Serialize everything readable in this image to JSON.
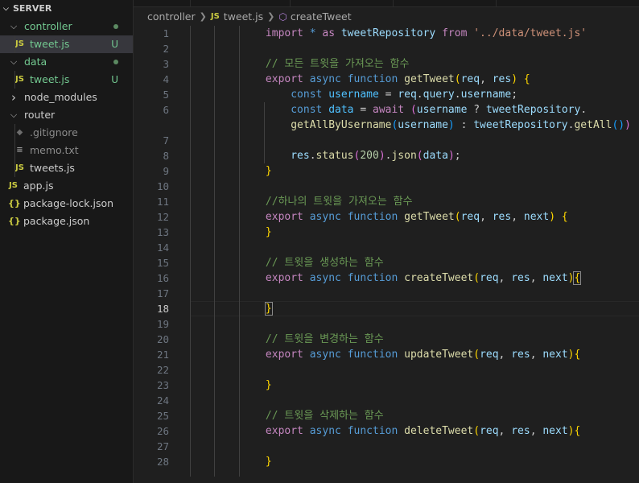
{
  "explorer": {
    "title": "SERVER",
    "items": [
      {
        "label": "controller",
        "type": "folder",
        "open": true,
        "level": 0,
        "status": "dot",
        "color": "green"
      },
      {
        "label": "tweet.js",
        "type": "js",
        "level": 1,
        "status": "U",
        "color": "green",
        "selected": true
      },
      {
        "label": "data",
        "type": "folder",
        "open": true,
        "level": 0,
        "status": "dot",
        "color": "green"
      },
      {
        "label": "tweet.js",
        "type": "js",
        "level": 1,
        "status": "U",
        "color": "green"
      },
      {
        "label": "node_modules",
        "type": "folder",
        "open": false,
        "level": 0
      },
      {
        "label": "router",
        "type": "folder",
        "open": true,
        "level": 0
      },
      {
        "label": ".gitignore",
        "type": "git",
        "level": 1,
        "color": "dim"
      },
      {
        "label": "memo.txt",
        "type": "txt",
        "level": 1,
        "color": "dim"
      },
      {
        "label": "tweets.js",
        "type": "js",
        "level": 1
      },
      {
        "label": "app.js",
        "type": "js",
        "level": 0
      },
      {
        "label": "package-lock.json",
        "type": "json",
        "level": 0
      },
      {
        "label": "package.json",
        "type": "json",
        "level": 0
      }
    ]
  },
  "breadcrumb": {
    "folder": "controller",
    "file_icon": "JS",
    "file": "tweet.js",
    "symbol": "createTweet"
  },
  "editor": {
    "active_line": 18,
    "lines": [
      {
        "n": "1",
        "tokens": [
          [
            "",
            "            "
          ],
          [
            "kw",
            "import"
          ],
          [
            "pn",
            " "
          ],
          [
            "kb",
            "*"
          ],
          [
            "pn",
            " "
          ],
          [
            "kw",
            "as"
          ],
          [
            "pn",
            " "
          ],
          [
            "var",
            "tweetRepository"
          ],
          [
            "pn",
            " "
          ],
          [
            "kw",
            "from"
          ],
          [
            "pn",
            " "
          ],
          [
            "str",
            "'../data/tweet.js'"
          ]
        ]
      },
      {
        "n": "2",
        "tokens": []
      },
      {
        "n": "3",
        "tokens": [
          [
            "",
            "            "
          ],
          [
            "cmt",
            "// 모든 트윗을 가져오는 함수"
          ]
        ]
      },
      {
        "n": "4",
        "tokens": [
          [
            "",
            "            "
          ],
          [
            "kw",
            "export"
          ],
          [
            "pn",
            " "
          ],
          [
            "kb",
            "async"
          ],
          [
            "pn",
            " "
          ],
          [
            "kb",
            "function"
          ],
          [
            "pn",
            " "
          ],
          [
            "fn",
            "getTweet"
          ],
          [
            "p1",
            "("
          ],
          [
            "var",
            "req"
          ],
          [
            "pn",
            ", "
          ],
          [
            "var",
            "res"
          ],
          [
            "p1",
            ")"
          ],
          [
            "pn",
            " "
          ],
          [
            "p1",
            "{"
          ]
        ]
      },
      {
        "n": "5",
        "tokens": [
          [
            "",
            "                "
          ],
          [
            "kb",
            "const"
          ],
          [
            "pn",
            " "
          ],
          [
            "cst",
            "username"
          ],
          [
            "pn",
            " = "
          ],
          [
            "var",
            "req"
          ],
          [
            "pn",
            "."
          ],
          [
            "var",
            "query"
          ],
          [
            "pn",
            "."
          ],
          [
            "var",
            "username"
          ],
          [
            "pn",
            ";"
          ]
        ]
      },
      {
        "n": "6",
        "tokens": [
          [
            "",
            "                "
          ],
          [
            "kb",
            "const"
          ],
          [
            "pn",
            " "
          ],
          [
            "cst",
            "data"
          ],
          [
            "pn",
            " = "
          ],
          [
            "kw",
            "await"
          ],
          [
            "pn",
            " "
          ],
          [
            "p2",
            "("
          ],
          [
            "var",
            "username"
          ],
          [
            "pn",
            " ? "
          ],
          [
            "var",
            "tweetRepository"
          ],
          [
            "pn",
            "."
          ]
        ]
      },
      {
        "n": "",
        "tokens": [
          [
            "",
            "                "
          ],
          [
            "fn",
            "getAllByUsername"
          ],
          [
            "p3",
            "("
          ],
          [
            "var",
            "username"
          ],
          [
            "p3",
            ")"
          ],
          [
            "pn",
            " : "
          ],
          [
            "var",
            "tweetRepository"
          ],
          [
            "pn",
            "."
          ],
          [
            "fn",
            "getAll"
          ],
          [
            "p3",
            "("
          ],
          [
            "p3",
            ")"
          ],
          [
            "p2",
            ")"
          ]
        ]
      },
      {
        "n": "7",
        "tokens": []
      },
      {
        "n": "8",
        "tokens": [
          [
            "",
            "                "
          ],
          [
            "var",
            "res"
          ],
          [
            "pn",
            "."
          ],
          [
            "fn",
            "status"
          ],
          [
            "p2",
            "("
          ],
          [
            "num",
            "200"
          ],
          [
            "p2",
            ")"
          ],
          [
            "pn",
            "."
          ],
          [
            "fn",
            "json"
          ],
          [
            "p2",
            "("
          ],
          [
            "var",
            "data"
          ],
          [
            "p2",
            ")"
          ],
          [
            "pn",
            ";"
          ]
        ]
      },
      {
        "n": "9",
        "tokens": [
          [
            "",
            "            "
          ],
          [
            "p1",
            "}"
          ]
        ]
      },
      {
        "n": "10",
        "tokens": []
      },
      {
        "n": "11",
        "tokens": [
          [
            "",
            "            "
          ],
          [
            "cmt",
            "//하나의 트윗을 가져오는 함수"
          ]
        ]
      },
      {
        "n": "12",
        "tokens": [
          [
            "",
            "            "
          ],
          [
            "kw",
            "export"
          ],
          [
            "pn",
            " "
          ],
          [
            "kb",
            "async"
          ],
          [
            "pn",
            " "
          ],
          [
            "kb",
            "function"
          ],
          [
            "pn",
            " "
          ],
          [
            "fn",
            "getTweet"
          ],
          [
            "p1",
            "("
          ],
          [
            "var",
            "req"
          ],
          [
            "pn",
            ", "
          ],
          [
            "var",
            "res"
          ],
          [
            "pn",
            ", "
          ],
          [
            "var",
            "next"
          ],
          [
            "p1",
            ")"
          ],
          [
            "pn",
            " "
          ],
          [
            "p1",
            "{"
          ]
        ]
      },
      {
        "n": "13",
        "tokens": [
          [
            "",
            "            "
          ],
          [
            "p1",
            "}"
          ]
        ]
      },
      {
        "n": "14",
        "tokens": []
      },
      {
        "n": "15",
        "tokens": [
          [
            "",
            "            "
          ],
          [
            "cmt",
            "// 트윗을 생성하는 함수"
          ]
        ]
      },
      {
        "n": "16",
        "tokens": [
          [
            "",
            "            "
          ],
          [
            "kw",
            "export"
          ],
          [
            "pn",
            " "
          ],
          [
            "kb",
            "async"
          ],
          [
            "pn",
            " "
          ],
          [
            "kb",
            "function"
          ],
          [
            "pn",
            " "
          ],
          [
            "fn",
            "createTweet"
          ],
          [
            "p1",
            "("
          ],
          [
            "var",
            "req"
          ],
          [
            "pn",
            ", "
          ],
          [
            "var",
            "res"
          ],
          [
            "pn",
            ", "
          ],
          [
            "var",
            "next"
          ],
          [
            "p1",
            ")"
          ],
          [
            "p1 bm",
            "{"
          ]
        ]
      },
      {
        "n": "17",
        "tokens": []
      },
      {
        "n": "18",
        "tokens": [
          [
            "",
            "            "
          ],
          [
            "p1 bm",
            "}"
          ]
        ]
      },
      {
        "n": "19",
        "tokens": []
      },
      {
        "n": "20",
        "tokens": [
          [
            "",
            "            "
          ],
          [
            "cmt",
            "// 트윗을 변경하는 함수"
          ]
        ]
      },
      {
        "n": "21",
        "tokens": [
          [
            "",
            "            "
          ],
          [
            "kw",
            "export"
          ],
          [
            "pn",
            " "
          ],
          [
            "kb",
            "async"
          ],
          [
            "pn",
            " "
          ],
          [
            "kb",
            "function"
          ],
          [
            "pn",
            " "
          ],
          [
            "fn",
            "updateTweet"
          ],
          [
            "p1",
            "("
          ],
          [
            "var",
            "req"
          ],
          [
            "pn",
            ", "
          ],
          [
            "var",
            "res"
          ],
          [
            "pn",
            ", "
          ],
          [
            "var",
            "next"
          ],
          [
            "p1",
            ")"
          ],
          [
            "p1",
            "{"
          ]
        ]
      },
      {
        "n": "22",
        "tokens": []
      },
      {
        "n": "23",
        "tokens": [
          [
            "",
            "            "
          ],
          [
            "p1",
            "}"
          ]
        ]
      },
      {
        "n": "24",
        "tokens": []
      },
      {
        "n": "25",
        "tokens": [
          [
            "",
            "            "
          ],
          [
            "cmt",
            "// 트윗을 삭제하는 함수"
          ]
        ]
      },
      {
        "n": "26",
        "tokens": [
          [
            "",
            "            "
          ],
          [
            "kw",
            "export"
          ],
          [
            "pn",
            " "
          ],
          [
            "kb",
            "async"
          ],
          [
            "pn",
            " "
          ],
          [
            "kb",
            "function"
          ],
          [
            "pn",
            " "
          ],
          [
            "fn",
            "deleteTweet"
          ],
          [
            "p1",
            "("
          ],
          [
            "var",
            "req"
          ],
          [
            "pn",
            ", "
          ],
          [
            "var",
            "res"
          ],
          [
            "pn",
            ", "
          ],
          [
            "var",
            "next"
          ],
          [
            "p1",
            ")"
          ],
          [
            "p1",
            "{"
          ]
        ]
      },
      {
        "n": "27",
        "tokens": []
      },
      {
        "n": "28",
        "tokens": [
          [
            "",
            "            "
          ],
          [
            "p1",
            "}"
          ]
        ]
      }
    ]
  }
}
